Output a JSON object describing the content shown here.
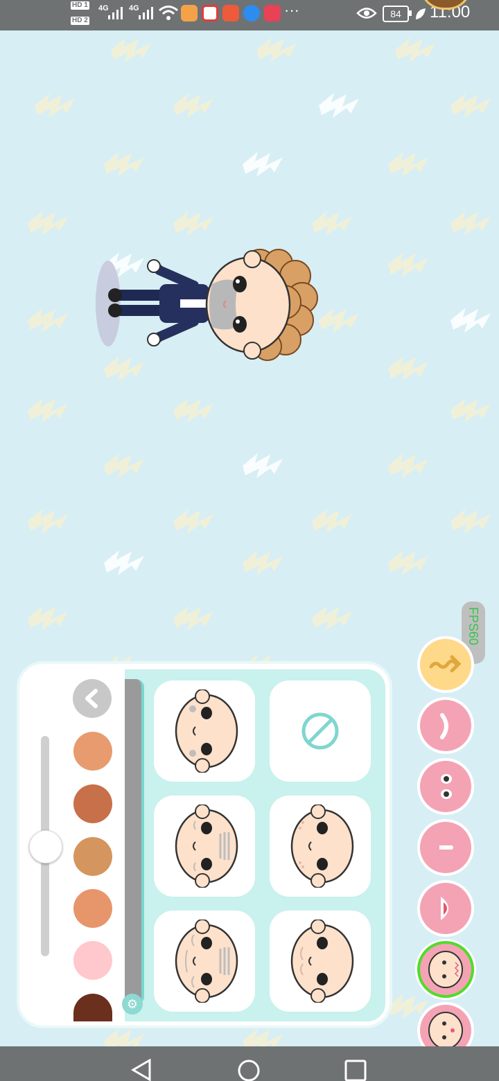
{
  "status_bar": {
    "sim1": "HD 1",
    "sim2": "HD 2",
    "net1": "4G",
    "net2": "4G",
    "more": "···",
    "battery": "84",
    "time": "11:00"
  },
  "fps_badge": "FPS60",
  "skin_colors": [
    "#e89b6e",
    "#c8704a",
    "#d5955e",
    "#e7966c",
    "#ffc8cc",
    "#6b2f1d"
  ],
  "categories": [
    {
      "name": "hair-icon",
      "color": "#ffd98a"
    },
    {
      "name": "eyebrow-icon",
      "color": "#f4a3b4"
    },
    {
      "name": "eyes-icon",
      "color": "#f4a3b4"
    },
    {
      "name": "nose-icon",
      "color": "#f4a3b4"
    },
    {
      "name": "mouth-icon",
      "color": "#f4a3b4"
    },
    {
      "name": "face-lines-icon",
      "color": "#f4a3b4",
      "selected": true
    },
    {
      "name": "face-marks-icon",
      "color": "#f4a3b4"
    }
  ],
  "face_options": [
    "none",
    "light-wrinkles",
    "forehead-wrinkles",
    "freckles",
    "deep-wrinkles",
    "cheek-lines"
  ]
}
